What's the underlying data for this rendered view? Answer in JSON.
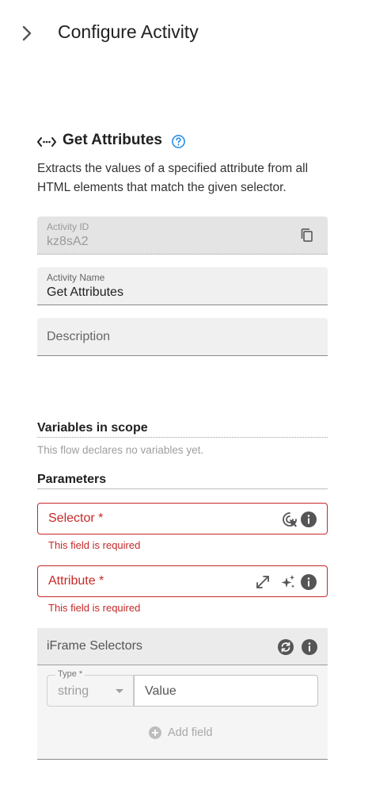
{
  "header": {
    "title": "Configure Activity"
  },
  "activity": {
    "name": "Get Attributes",
    "description": "Extracts the values of a specified attribute from all HTML elements that match the given selector."
  },
  "fields": {
    "activity_id": {
      "label": "Activity ID",
      "value": "kz8sA2"
    },
    "activity_name": {
      "label": "Activity Name",
      "value": "Get Attributes"
    },
    "description": {
      "placeholder": "Description"
    }
  },
  "variables": {
    "title": "Variables in scope",
    "empty_text": "This flow declares no variables yet."
  },
  "parameters": {
    "title": "Parameters",
    "selector": {
      "label": "Selector *",
      "error": "This field is required"
    },
    "attribute": {
      "label": "Attribute *",
      "error": "This field is required"
    },
    "iframe_selectors": {
      "label": "iFrame Selectors",
      "type_label": "Type *",
      "type_value": "string",
      "value_placeholder": "Value",
      "add_field_label": "Add field"
    }
  },
  "colors": {
    "error": "#c62828",
    "accent": "#1e88e5",
    "field_bg": "#f0f0f0"
  },
  "icons": [
    "chevron-right-icon",
    "code-arrows-icon",
    "help-circle-icon",
    "copy-icon",
    "target-cursor-icon",
    "info-icon",
    "expand-icon",
    "sparkle-icon",
    "refresh-icon",
    "add-circle-icon"
  ]
}
